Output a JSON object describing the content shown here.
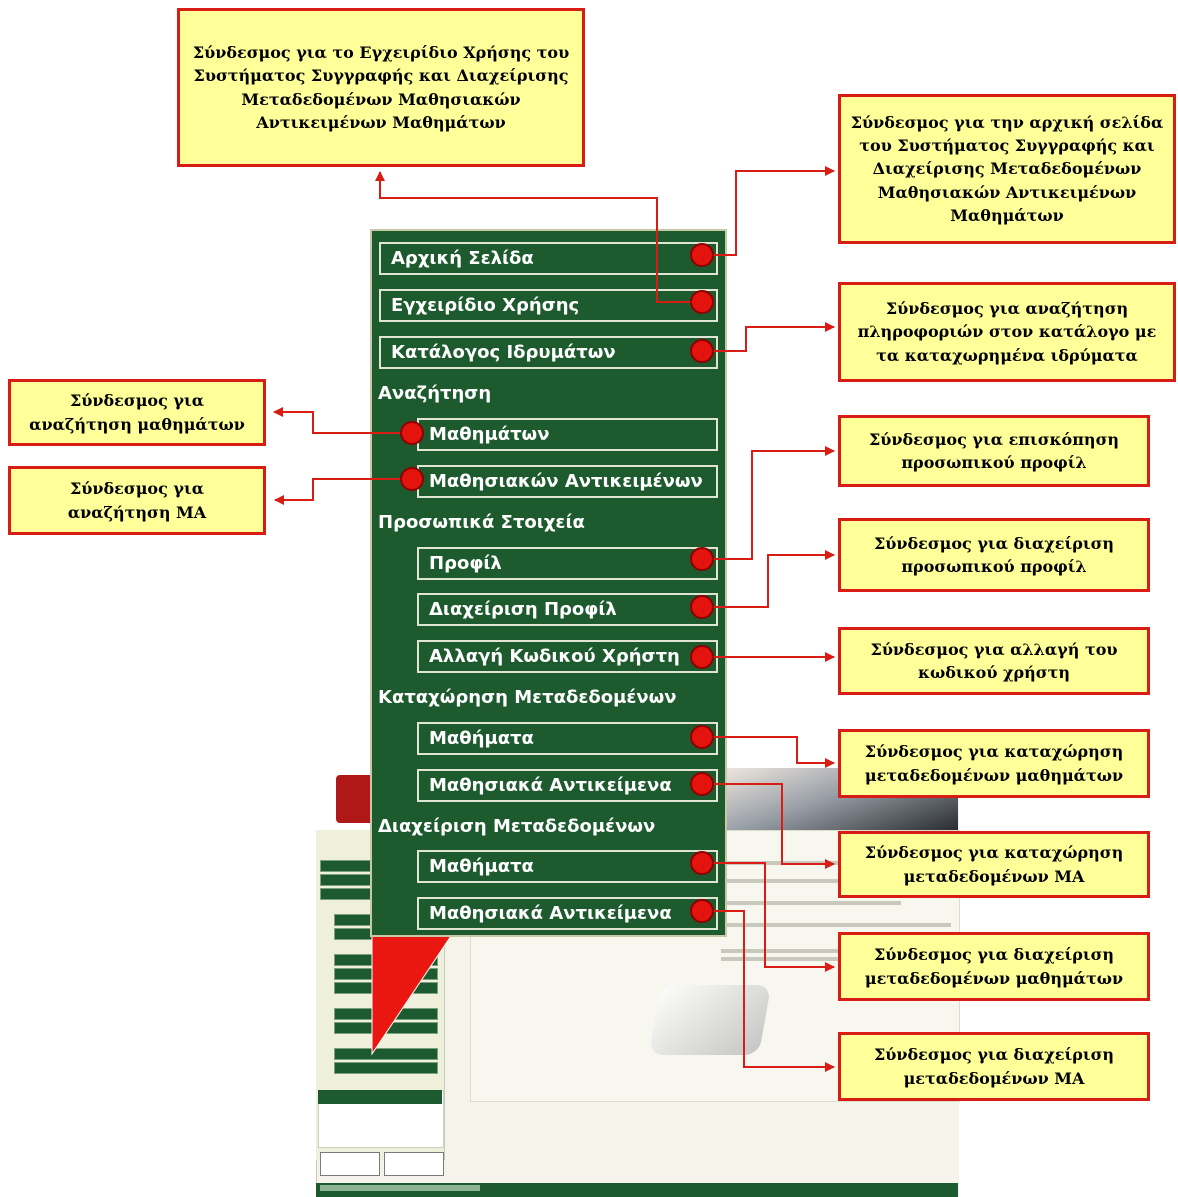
{
  "menu": {
    "home": "Αρχική Σελίδα",
    "manual": "Εγχειρίδιο Χρήσης",
    "catalog": "Κατάλογος Ιδρυμάτων",
    "search_heading": "Αναζήτηση",
    "search_courses": "Μαθημάτων",
    "search_objects": "Μαθησιακών Αντικειμένων",
    "personal_heading": "Προσωπικά Στοιχεία",
    "profile": "Προφίλ",
    "profile_manage": "Διαχείριση Προφίλ",
    "password_change": "Αλλαγή Κωδικού Χρήστη",
    "register_heading": "Καταχώρηση Μεταδεδομένων",
    "register_courses": "Μαθήματα",
    "register_objects": "Μαθησιακά Αντικείμενα",
    "manage_heading": "Διαχείριση Μεταδεδομένων",
    "manage_courses": "Μαθήματα",
    "manage_objects": "Μαθησιακά Αντικείμενα"
  },
  "callouts": {
    "manual": "Σύνδεσμος για το Εγχειρίδιο Χρήσης του Συστήματος Συγγραφής και Διαχείρισης Μεταδεδομένων Μαθησιακών Αντικειμένων Μαθημάτων",
    "home": "Σύνδεσμος για την αρχική σελίδα του Συστήματος Συγγραφής και Διαχείρισης Μεταδεδομένων Μαθησιακών Αντικειμένων Μαθημάτων",
    "catalog": "Σύνδεσμος για αναζήτηση πληροφοριών στον κατάλογο με τα καταχωρημένα ιδρύματα",
    "search_courses": "Σύνδεσμος για αναζήτηση μαθημάτων",
    "search_objects": "Σύνδεσμος για αναζήτηση ΜΑ",
    "profile": "Σύνδεσμος για επισκόπηση προσωπικού προφίλ",
    "profile_manage": "Σύνδεσμος για διαχείριση προσωπικού προφίλ",
    "password_change": "Σύνδεσμος για αλλαγή του κωδικού χρήστη",
    "register_courses": "Σύνδεσμος για καταχώρηση μεταδεδομένων μαθημάτων",
    "register_objects": "Σύνδεσμος για καταχώρηση μεταδεδομένων ΜΑ",
    "manage_courses": "Σύνδεσμος για διαχείριση μεταδεδομένων μαθημάτων",
    "manage_objects": "Σύνδεσμος για διαχείριση μεταδεδομένων ΜΑ"
  },
  "colors": {
    "menu_bg": "#1d5a2e",
    "callout_bg": "#ffff99",
    "callout_border": "#d91d14",
    "connector": "#d91d14",
    "dot": "#e3140d"
  }
}
